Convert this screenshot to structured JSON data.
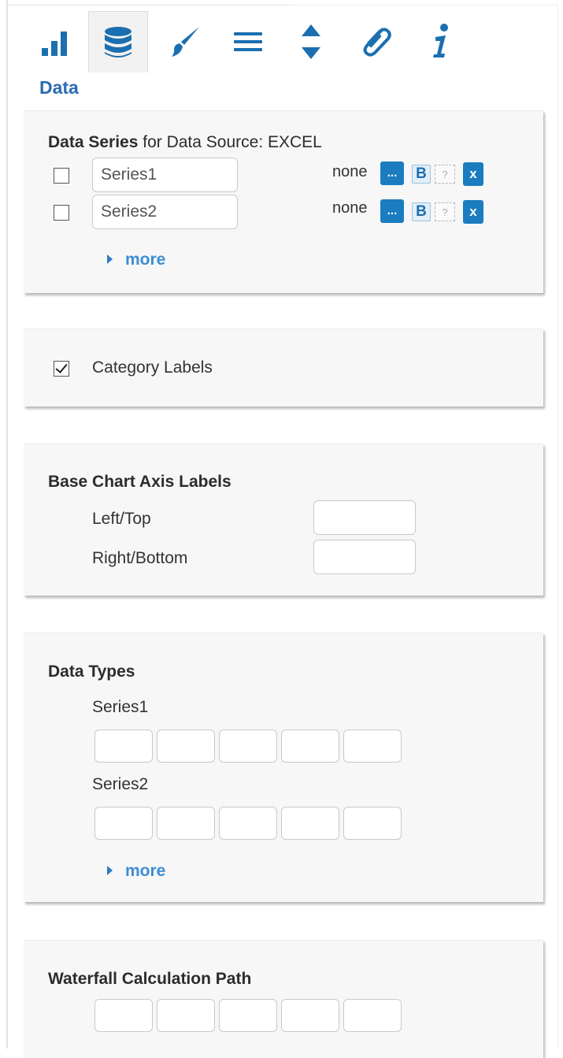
{
  "toolbar": {
    "tools": [
      {
        "icon": "bar-chart-icon",
        "active": false
      },
      {
        "icon": "database-icon",
        "active": true
      },
      {
        "icon": "brush-icon",
        "active": false
      },
      {
        "icon": "lines-icon",
        "active": false
      },
      {
        "icon": "sort-arrows-icon",
        "active": false
      },
      {
        "icon": "paperclip-icon",
        "active": false
      },
      {
        "icon": "info-icon",
        "active": false
      }
    ],
    "active_color": "#1b6fb0"
  },
  "section_title": "Data",
  "data_series": {
    "title_bold": "Data Series",
    "title_normal": " for Data Source: EXCEL",
    "rows": [
      {
        "name": "Series1",
        "checked": false,
        "status": "none",
        "dots_label": "...",
        "b_label": "B",
        "q_label": "?",
        "x_label": "x"
      },
      {
        "name": "Series2",
        "checked": false,
        "status": "none",
        "dots_label": "...",
        "b_label": "B",
        "q_label": "?",
        "x_label": "x"
      }
    ],
    "more_label": "more"
  },
  "category_labels": {
    "label": "Category Labels",
    "checked": true
  },
  "axis_labels": {
    "title": "Base Chart Axis Labels",
    "left_top": "Left/Top",
    "right_bottom": "Right/Bottom",
    "left_top_value": "",
    "right_bottom_value": ""
  },
  "data_types": {
    "title": "Data Types",
    "series1": "Series1",
    "series2": "Series2",
    "more_label": "more"
  },
  "waterfall": {
    "title": "Waterfall Calculation Path"
  },
  "colors": {
    "accent": "#1b7dc0",
    "title_blue": "#2b6bb1",
    "link_blue": "#3b8ed5"
  }
}
